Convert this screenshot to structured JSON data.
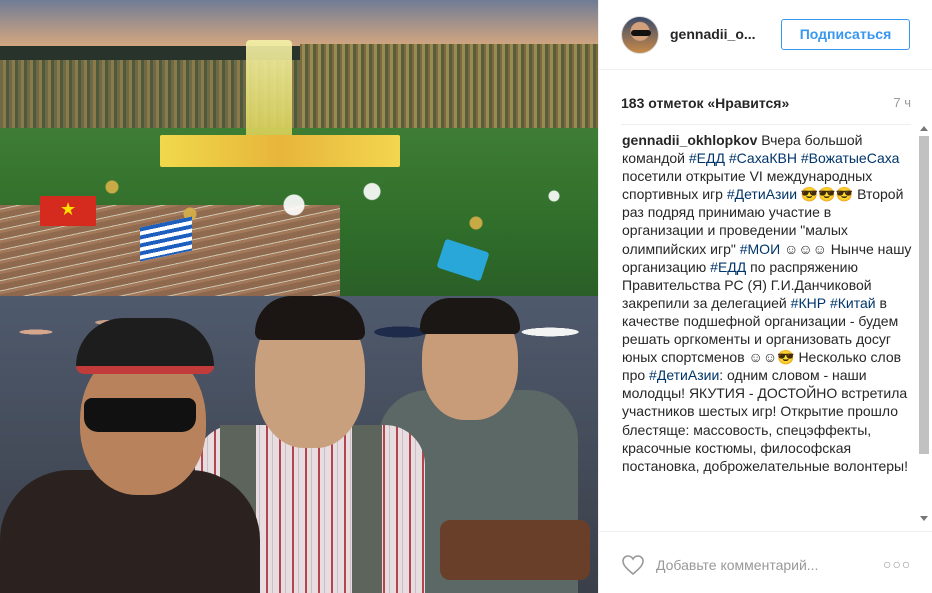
{
  "post": {
    "username": "gennadii_o...",
    "follow_label": "Подписаться",
    "likes": "183 отметок «Нравится»",
    "time": "7 ч",
    "comment_author": "gennadii_okhlopkov",
    "comment_parts": [
      {
        "t": "text",
        "v": " Вчера большой командой "
      },
      {
        "t": "tag",
        "v": "#ЕДД"
      },
      {
        "t": "text",
        "v": " "
      },
      {
        "t": "tag",
        "v": "#СахаКВН"
      },
      {
        "t": "text",
        "v": " "
      },
      {
        "t": "tag",
        "v": "#ВожатыеСаха"
      },
      {
        "t": "text",
        "v": " посетили открытие VI международных спортивных игр "
      },
      {
        "t": "tag",
        "v": "#ДетиАзии"
      },
      {
        "t": "text",
        "v": " 😎😎😎 Второй раз подряд принимаю участие в организации и проведении \"малых олимпийских игр\" "
      },
      {
        "t": "tag",
        "v": "#МОИ"
      },
      {
        "t": "text",
        "v": " ☺☺☺ Нынче нашу организацию "
      },
      {
        "t": "tag",
        "v": "#ЕДД"
      },
      {
        "t": "text",
        "v": " по распряжению Правительства РС (Я) Г.И.Данчиковой закрепили за делегацией "
      },
      {
        "t": "tag",
        "v": "#КНР"
      },
      {
        "t": "text",
        "v": " "
      },
      {
        "t": "tag",
        "v": "#Китай"
      },
      {
        "t": "text",
        "v": " в качестве подшефной организации - будем решать оргкоменты и организовать досуг юных спортсменов ☺☺😎 Несколько слов про "
      },
      {
        "t": "tag",
        "v": "#ДетиАзии"
      },
      {
        "t": "text",
        "v": ": одним словом - наши молодцы! ЯКУТИЯ - ДОСТОЙНО встретила участников шестых игр! Открытие прошло блестяще: массовость, спецэффекты, красочные костюмы, философская постановка, доброжелательные волонтеры!"
      }
    ],
    "comment_placeholder": "Добавьте комментарий...",
    "more_label": "○○○"
  },
  "colors": {
    "link": "#003569",
    "follow": "#3897f0",
    "muted": "#999999"
  },
  "icons": {
    "heart": "heart-outline-icon",
    "more": "more-options-icon",
    "avatar": "user-avatar"
  }
}
